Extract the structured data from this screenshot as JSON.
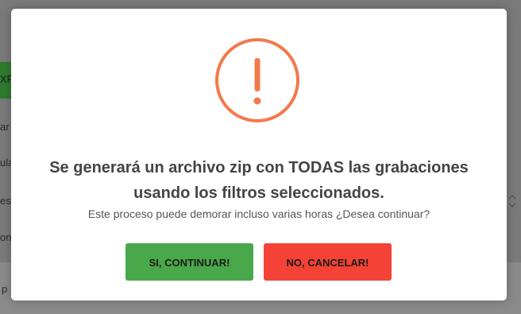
{
  "background": {
    "green_button_fragment": "XP",
    "side_fragments": [
      "ar",
      "ula",
      "es",
      "on"
    ],
    "bottom_fragment": "p",
    "select_chevron": "chevron-down-icon"
  },
  "dialog": {
    "icon": "exclamation-icon",
    "title_line1": "Se generará un archivo zip con TODAS las grabaciones",
    "title_line2": "usando los filtros seleccionados.",
    "message": "Este proceso puede demorar incluso varias horas ¿Desea continuar?",
    "confirm_label": "SI, CONTINUAR!",
    "cancel_label": "NO, CANCELAR!"
  },
  "colors": {
    "warning": "#f27a4a",
    "confirm": "#49a849",
    "cancel": "#f44336"
  }
}
